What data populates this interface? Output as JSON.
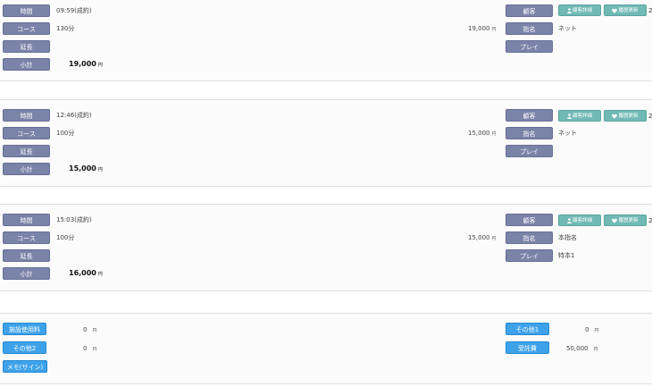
{
  "records": [
    {
      "time_label": "時間",
      "time_value": "09:59(成約)",
      "course_label": "コース",
      "course_value": "130分",
      "course_price": "19,000",
      "ext_label": "延長",
      "subtotal_label": "小計",
      "subtotal_value": "19,000",
      "customer_label": "顧客",
      "detail_button": "顧客詳細",
      "history_button": "履歴更新",
      "edge_text": "2",
      "nomination_label": "指名",
      "nomination_value": "ネット",
      "play_label": "プレイ",
      "play_value": ""
    },
    {
      "time_label": "時間",
      "time_value": "12:46(成約)",
      "course_label": "コース",
      "course_value": "100分",
      "course_price": "15,000",
      "ext_label": "延長",
      "subtotal_label": "小計",
      "subtotal_value": "15,000",
      "customer_label": "顧客",
      "detail_button": "顧客詳細",
      "history_button": "履歴更新",
      "edge_text": "2",
      "nomination_label": "指名",
      "nomination_value": "ネット",
      "play_label": "プレイ",
      "play_value": ""
    },
    {
      "time_label": "時間",
      "time_value": "15:03(成約)",
      "course_label": "コース",
      "course_value": "100分",
      "course_price": "15,000",
      "ext_label": "延長",
      "subtotal_label": "小計",
      "subtotal_value": "16,000",
      "customer_label": "顧客",
      "detail_button": "顧客詳細",
      "history_button": "履歴更新",
      "edge_text": "2",
      "nomination_label": "指名",
      "nomination_value": "本指名",
      "play_label": "プレイ",
      "play_value": "特本1"
    }
  ],
  "currency": "円",
  "summary": {
    "facility_label": "施設使用料",
    "facility_value": "0",
    "other1_label": "その他1",
    "other1_value": "0",
    "other2_label": "その他2",
    "other2_value": "0",
    "deposit_label": "受託費",
    "deposit_value": "50,000",
    "memo_label": "メモ(サイン)"
  },
  "colors": {
    "label_bg": "#7a83a8",
    "blue_label_bg": "#3ea2ea",
    "teal_button_bg": "#71b9b5",
    "panel_bg": "#fcfbfc"
  }
}
